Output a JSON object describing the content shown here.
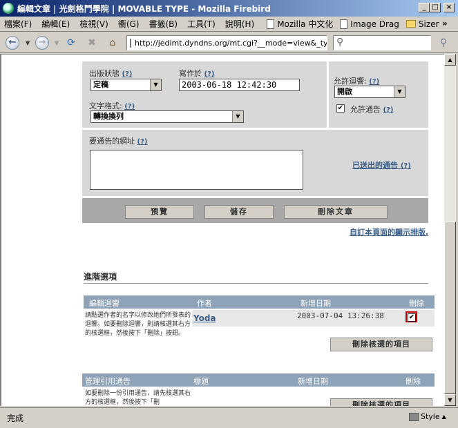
{
  "window": {
    "title": "編輯文章 | 光劍格鬥學院 | MOVABLE TYPE - Mozilla Firebird",
    "min": "_",
    "max": "□",
    "close": "×"
  },
  "menu": {
    "items": [
      "檔案(F)",
      "編輯(E)",
      "檢視(V)",
      "衝(G)",
      "書籤(B)",
      "工具(T)",
      "說明(H)"
    ],
    "bookmarks": [
      "Mozilla 中文化",
      "Image Drag",
      "Sizer"
    ],
    "overflow": "»"
  },
  "nav": {
    "url": "http://jedimt.dyndns.org/mt.cgi?__mode=view&_typ",
    "search_placeholder": ""
  },
  "form": {
    "status_label": "出版狀態",
    "status_value": "定稿",
    "written_label": "寫作於",
    "written_value": "2003-06-18 12:42:30",
    "allow_comments_label": "允許迴響:",
    "allow_comments_value": "開啟",
    "allow_pings_label": "允許通告",
    "format_label": "文字格式:",
    "format_value": "轉換換列",
    "ping_urls_label": "要通告的網址",
    "sent_pings_link": "已送出的通告",
    "help": "(?)"
  },
  "buttons": {
    "preview": "預覽",
    "save": "儲存",
    "delete": "刪除文章"
  },
  "customize_link": "自訂本頁面的顯示排版.",
  "advanced": {
    "title": "進階選項",
    "comments": {
      "headers": [
        "編輯迴響",
        "作者",
        "新增日期",
        "刪除"
      ],
      "help_text": "請點選作者的名字以修改她們所發表的迴響。如要刪除迴響，則請核選其右方的核選框，然後按下「刪除」按鈕。",
      "row": {
        "author": "Yoda",
        "date": "2003-07-04 13:26:38",
        "checked": true
      },
      "delete_button": "刪除核選的項目"
    },
    "trackbacks": {
      "headers": [
        "管理引用通告",
        "標題",
        "新增日期",
        "刪除"
      ],
      "help_text": "如要刪除一份引用通告，請先核選其右方的核選框，然後按下「刪",
      "delete_button": "刪除核選的項目"
    }
  },
  "status": {
    "text": "完成",
    "style": "Style"
  },
  "colors": {
    "accent": "#8fa3b8",
    "panel": "#d8d8d8",
    "link": "#3a5f8a",
    "highlight_box": "#cc0000"
  }
}
